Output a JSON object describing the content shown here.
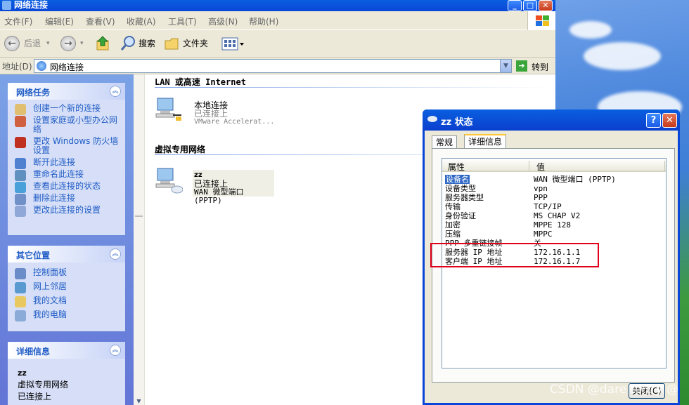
{
  "window": {
    "title": "网络连接"
  },
  "menu": [
    "文件(F)",
    "编辑(E)",
    "查看(V)",
    "收藏(A)",
    "工具(T)",
    "高级(N)",
    "帮助(H)"
  ],
  "toolbar": {
    "back": "后退",
    "search": "搜索",
    "folders": "文件夹"
  },
  "address": {
    "label": "地址(D)",
    "value": "网络连接",
    "go": "转到"
  },
  "taskpane": {
    "network_tasks": {
      "title": "网络任务",
      "items": [
        "创建一个新的连接",
        "设置家庭或小型办公网络",
        "更改 Windows 防火墙设置",
        "断开此连接",
        "重命名此连接",
        "查看此连接的状态",
        "删除此连接",
        "更改此连接的设置"
      ]
    },
    "other_places": {
      "title": "其它位置",
      "items": [
        "控制面板",
        "网上邻居",
        "我的文档",
        "我的电脑"
      ]
    },
    "details": {
      "title": "详细信息",
      "lines": [
        "zz",
        "虚拟专用网络",
        "已连接上"
      ]
    }
  },
  "content": {
    "group_lan": "LAN 或高速 Internet",
    "lan_conn": {
      "name": "本地连接",
      "status": "已连接上",
      "device": "VMware Accelerat..."
    },
    "group_vpn": "虚拟专用网络",
    "vpn_conn": {
      "name": "zz",
      "status": "已连接上",
      "device": "WAN 微型端口 (PPTP)"
    }
  },
  "dialog": {
    "title": "zz 状态",
    "tabs": [
      "常规",
      "详细信息"
    ],
    "columns": [
      "属性",
      "值"
    ],
    "rows": [
      {
        "p": "设备名",
        "v": "WAN 微型端口 (PPTP)"
      },
      {
        "p": "设备类型",
        "v": "vpn"
      },
      {
        "p": "服务器类型",
        "v": "PPP"
      },
      {
        "p": "传输",
        "v": "TCP/IP"
      },
      {
        "p": "身份验证",
        "v": "MS CHAP V2"
      },
      {
        "p": "加密",
        "v": "MPPE 128"
      },
      {
        "p": "压缩",
        "v": "MPPC"
      },
      {
        "p": "PPP 多重链接帧",
        "v": "关"
      },
      {
        "p": "服务器 IP 地址",
        "v": "172.16.1.1"
      },
      {
        "p": "客户端 IP 地址",
        "v": "172.16.1.7"
      }
    ],
    "close": "关闭(C)"
  },
  "watermark": "CSDN @dare to try @"
}
